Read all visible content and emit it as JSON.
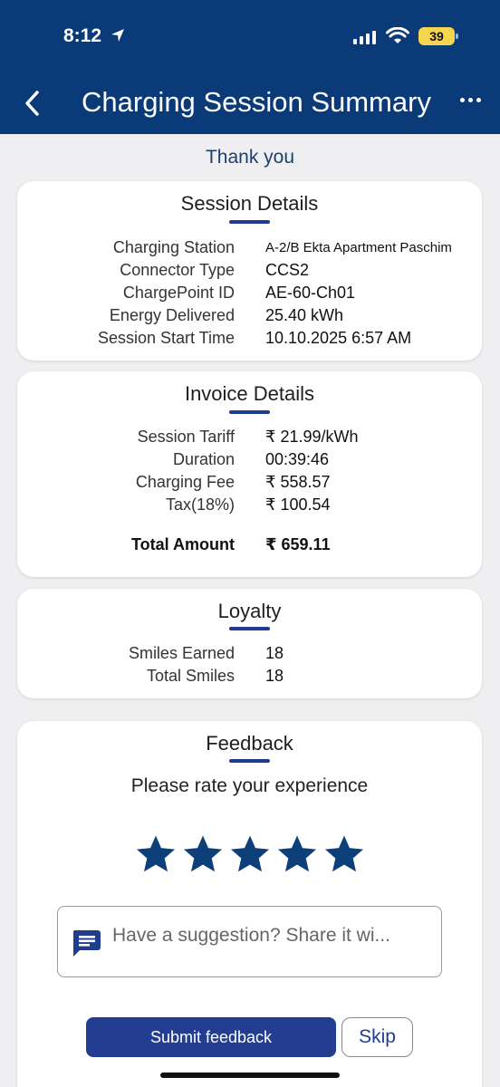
{
  "status_bar": {
    "time": "8:12",
    "battery": "39"
  },
  "header": {
    "title": "Charging Session Summary",
    "back_icon": "chevron-left-icon",
    "menu_icon": "more-horizontal-icon"
  },
  "thank_you": "Thank you",
  "session_details": {
    "title": "Session Details",
    "rows": [
      {
        "label": "Charging Station",
        "value": "A-2/B Ekta Apartment Paschim"
      },
      {
        "label": "Connector Type",
        "value": "CCS2"
      },
      {
        "label": "ChargePoint ID",
        "value": "AE-60-Ch01"
      },
      {
        "label": "Energy Delivered",
        "value": "25.40 kWh"
      },
      {
        "label": "Session Start Time",
        "value": "10.10.2025 6:57 AM"
      }
    ]
  },
  "invoice_details": {
    "title": "Invoice Details",
    "rows": [
      {
        "label": "Session Tariff",
        "value": "₹ 21.99/kWh"
      },
      {
        "label": "Duration",
        "value": "00:39:46"
      },
      {
        "label": "Charging Fee",
        "value": "₹ 558.57"
      },
      {
        "label": "Tax(18%)",
        "value": "₹ 100.54"
      }
    ],
    "total": {
      "label": "Total Amount",
      "value": "₹ 659.11"
    }
  },
  "loyalty": {
    "title": "Loyalty",
    "rows": [
      {
        "label": "Smiles Earned",
        "value": "18"
      },
      {
        "label": "Total Smiles",
        "value": "18"
      }
    ]
  },
  "feedback": {
    "title": "Feedback",
    "prompt": "Please rate your experience",
    "rating": 5,
    "rating_max": 5,
    "star_color": "#0d3f79",
    "suggestion_placeholder": "Have a suggestion? Share it wi...",
    "submit_label": "Submit feedback",
    "skip_label": "Skip"
  },
  "colors": {
    "header_bg": "#0a3a78",
    "accent": "#233e91",
    "battery": "#f3d54e"
  }
}
